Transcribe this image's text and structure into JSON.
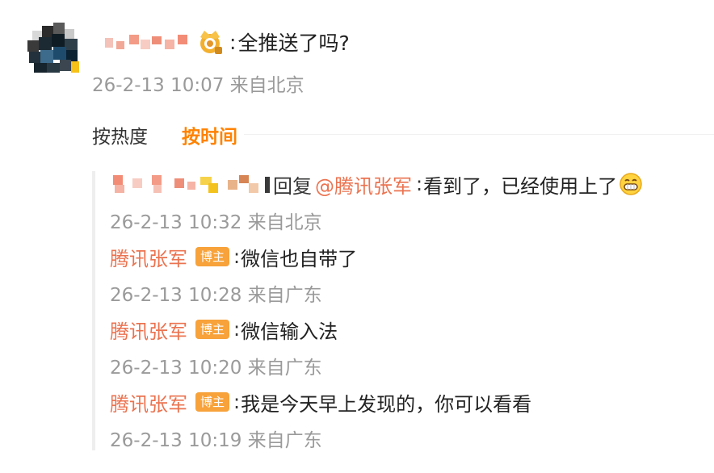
{
  "main_comment": {
    "message": "全推送了吗?",
    "colon": ":",
    "meta": "26-2-13 10:07 来自北京"
  },
  "sort": {
    "hot_label": "按热度",
    "time_label": "按时间",
    "active_color": "#ff8200"
  },
  "replies": [
    {
      "reply_word": "回复",
      "mention": "@腾讯张军",
      "colon": ":",
      "message": "看到了，已经使用上了",
      "emoji": "grin-emoji",
      "meta": "26-2-13 10:32 来自北京"
    },
    {
      "user": "腾讯张军",
      "badge": "博主",
      "colon": ":",
      "message": "微信也自带了",
      "meta": "26-2-13 10:28 来自广东"
    },
    {
      "user": "腾讯张军",
      "badge": "博主",
      "colon": ":",
      "message": "微信输入法",
      "meta": "26-2-13 10:20 来自广东"
    },
    {
      "user": "腾讯张军",
      "badge": "博主",
      "colon": ":",
      "message": "我是今天早上发现的，你可以看看",
      "meta": "26-2-13 10:19 来自广东"
    }
  ],
  "colors": {
    "username": "#eb7350",
    "badge_bg": "#f7a23a",
    "meta_text": "#9a9a9a"
  }
}
